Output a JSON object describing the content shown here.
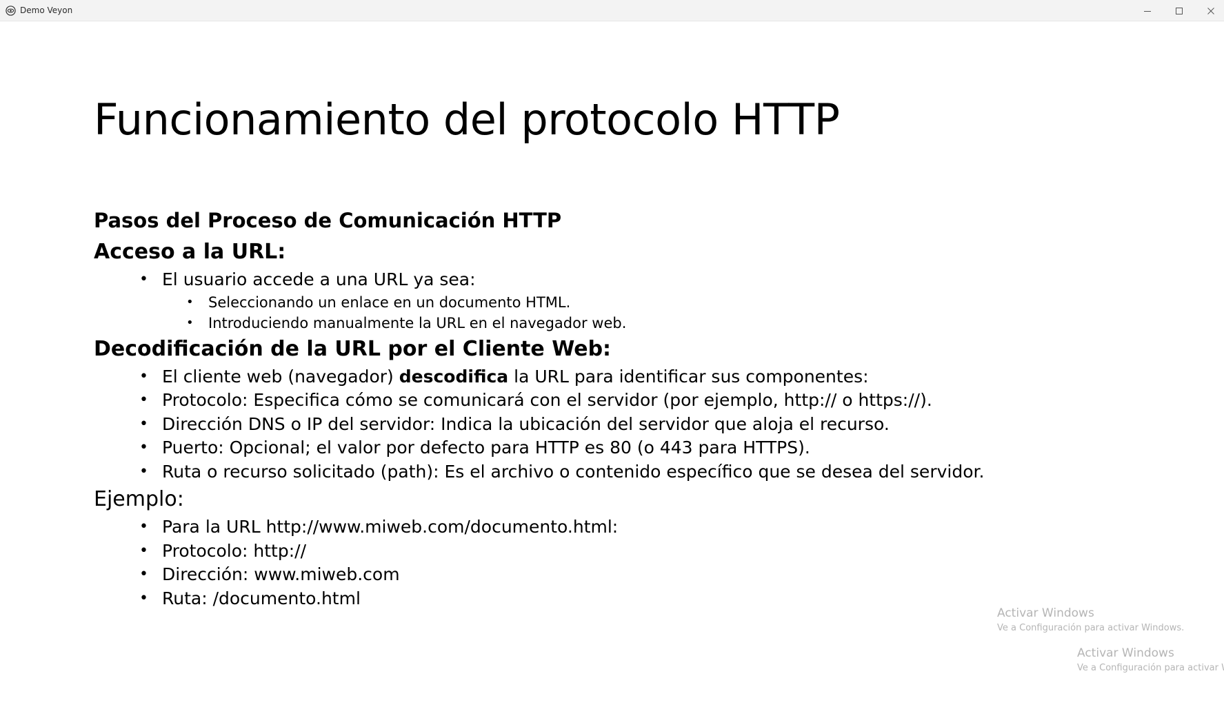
{
  "window": {
    "title": "Demo Veyon"
  },
  "slide": {
    "title": "Funcionamiento del protocolo HTTP",
    "subtitle": "Pasos del Proceso de Comunicación HTTP",
    "section1": {
      "heading": "Acceso a la URL:",
      "item": "El usuario accede a una URL ya sea:",
      "subitems": [
        "Seleccionando un enlace en un documento HTML.",
        "Introduciendo manualmente la URL en el navegador web."
      ]
    },
    "section2": {
      "heading": "Decodificación de la URL por el Cliente Web:",
      "item0_before": "El cliente web (navegador) ",
      "item0_bold": "descodifica",
      "item0_after": " la URL para identificar sus componentes:",
      "items": [
        "Protocolo: Especifica cómo se comunicará con el servidor (por ejemplo, http:// o https://).",
        "Dirección DNS o IP del servidor: Indica la ubicación del servidor que aloja el recurso.",
        "Puerto: Opcional; el valor por defecto para HTTP es 80 (o 443 para HTTPS).",
        "Ruta o recurso solicitado (path): Es el archivo o contenido específico que se desea del servidor."
      ]
    },
    "section3": {
      "heading": "Ejemplo:",
      "items": [
        "Para la URL http://www.miweb.com/documento.html:",
        "Protocolo: http://",
        "Dirección: www.miweb.com",
        "Ruta: /documento.html"
      ]
    }
  },
  "watermarks": [
    {
      "line1": "Activar Windows",
      "line2": "Ve a Configuración para activar Windows."
    },
    {
      "line1": "Activar Windows",
      "line2": "Ve a Configuración para activar Windows."
    }
  ],
  "icons": {
    "app": "veyon-eye-icon",
    "minimize": "minimize-icon",
    "maximize": "maximize-icon",
    "close": "close-icon"
  }
}
